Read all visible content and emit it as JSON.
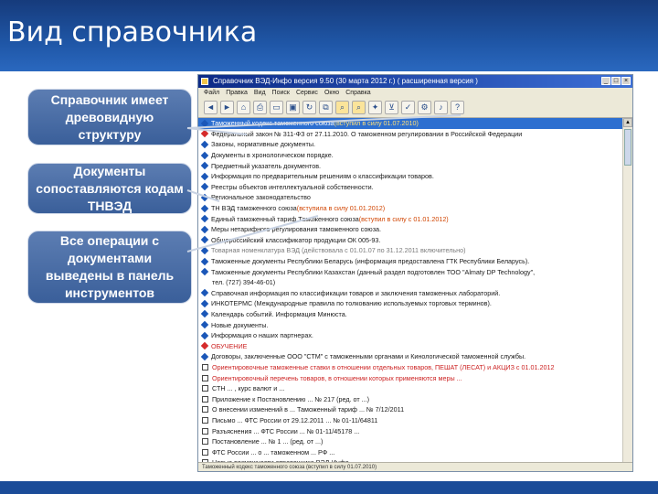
{
  "slide": {
    "title": "Вид справочника",
    "callouts": [
      "Справочник имеет древовидную структуру",
      "Документы сопоставляются кодам ТНВЭД",
      "Все операции с документами выведены в панель инструментов"
    ]
  },
  "app": {
    "window_title": "Справочник ВЭД-Инфо версия 9.50 (30 марта 2012 г.) ( расширенная версия )",
    "menu": [
      "Файл",
      "Правка",
      "Вид",
      "Поиск",
      "Сервис",
      "Окно",
      "Справка"
    ],
    "toolbar_icons": [
      "back-icon",
      "forward-icon",
      "home-icon",
      "print-icon",
      "open-icon",
      "save-icon",
      "refresh-icon",
      "copy-icon",
      "search-icon",
      "find-icon",
      "bookmark-icon",
      "filter-icon",
      "mark-icon",
      "settings-icon",
      "sound-icon",
      "help-icon"
    ],
    "rows": [
      {
        "icon": "blue",
        "text": "Таможенный кодекс таможенного союза ",
        "hl": "(вступил в силу 01.07.2010)",
        "style": "sel"
      },
      {
        "icon": "red",
        "text": "Федеральный закон № 311-ФЗ от 27.11.2010. О таможенном регулировании в Российской Федерации",
        "style": ""
      },
      {
        "icon": "blue",
        "text": "Законы, нормативные документы.",
        "style": ""
      },
      {
        "icon": "blue",
        "text": "Документы в хронологическом порядке.",
        "style": ""
      },
      {
        "icon": "blue",
        "text": "Предметный указатель документов.",
        "style": ""
      },
      {
        "icon": "blue",
        "text": "Информация по предварительным решениям о классификации товаров.",
        "style": ""
      },
      {
        "icon": "blue",
        "text": "Реестры объектов интеллектуальной собственности.",
        "style": ""
      },
      {
        "icon": "blue",
        "text": "Региональное законодательство",
        "style": ""
      },
      {
        "icon": "blue",
        "text": "ТН ВЭД таможенного союза ",
        "hl": "(вступила в силу 01.01.2012)",
        "style": ""
      },
      {
        "icon": "blue",
        "text": "Единый таможенный тариф Таможенного союза ",
        "hl": "(вступил в силу с 01.01.2012)",
        "style": ""
      },
      {
        "icon": "blue",
        "text": "Меры нетарифного регулирования таможенного союза.",
        "style": ""
      },
      {
        "icon": "blue",
        "text": "Общероссийский классификатор продукции ОК 005-93.",
        "style": ""
      },
      {
        "icon": "blue",
        "text": "Товарная номенклатура ВЭД (действовала с 01.01.07 по 31.12.2011 включительно)",
        "style": "grey"
      },
      {
        "icon": "blue",
        "text": "Таможенные документы Республики Беларусь (информация предоставлена ГТК Республики Беларусь).",
        "style": ""
      },
      {
        "icon": "blue",
        "text": "Таможенные документы Республики Казахстан (данный раздел подготовлен ТОО \"Almaty DP Technology\",",
        "style": ""
      },
      {
        "icon": "none",
        "text": "  тел. (727) 394-46-01)",
        "style": ""
      },
      {
        "icon": "blue",
        "text": "Справочная информация по классификации товаров и заключения таможенных лабораторий.",
        "style": ""
      },
      {
        "icon": "blue",
        "text": "ИНКОТЕРМС (Международные правила по толкованию используемых торговых терминов).",
        "style": ""
      },
      {
        "icon": "blue",
        "text": "Календарь событий. Информация Минюста.",
        "style": ""
      },
      {
        "icon": "blue",
        "text": "Новые документы.",
        "style": ""
      },
      {
        "icon": "blue",
        "text": "Информация о наших партнерах.",
        "style": ""
      },
      {
        "icon": "red",
        "text": "ОБУЧЕНИЕ",
        "style": "red"
      },
      {
        "icon": "blue",
        "text": "Договоры, заключенные ООО \"СТМ\" с таможенными органами и Кинологической таможенной службы.",
        "style": ""
      },
      {
        "icon": "doc",
        "text": "Ориентировочные таможенные ставки в отношении отдельных товаров, ПЕШАТ (ЛЕСАТ) и АКЦИЗ с 01.01.2012",
        "style": "red"
      },
      {
        "icon": "doc",
        "text": "Ориентировочный перечень товаров, в отношении которых применяются меры ... ",
        "style": "red"
      },
      {
        "icon": "doc",
        "text": "СТН ... , курс валют и ...",
        "style": ""
      },
      {
        "icon": "doc",
        "text": "Приложение к Постановлению ... № 217 (ред. от ...)",
        "style": ""
      },
      {
        "icon": "doc",
        "text": "О внесении изменений в ... Таможенный тариф ... № 7/12/2011",
        "style": ""
      },
      {
        "icon": "doc",
        "text": "Письмо ... ФТС России от 29.12.2011 ... № 01-11/64811",
        "style": ""
      },
      {
        "icon": "doc",
        "text": "Разъяснения ... ФТС России ... № 01-11/45178 ...",
        "style": ""
      },
      {
        "icon": "doc",
        "text": "Постановление ... № 1 ... (ред. от ...)",
        "style": ""
      },
      {
        "icon": "doc",
        "text": "ФТС России ... о ... таможенном ... РФ ...",
        "style": ""
      },
      {
        "icon": "doc",
        "text": "Новые возможности справочника ВЭД-Инфо.",
        "style": ""
      }
    ],
    "status": "Таможенный кодекс таможенного союза (вступил в силу 01.07.2010)"
  }
}
